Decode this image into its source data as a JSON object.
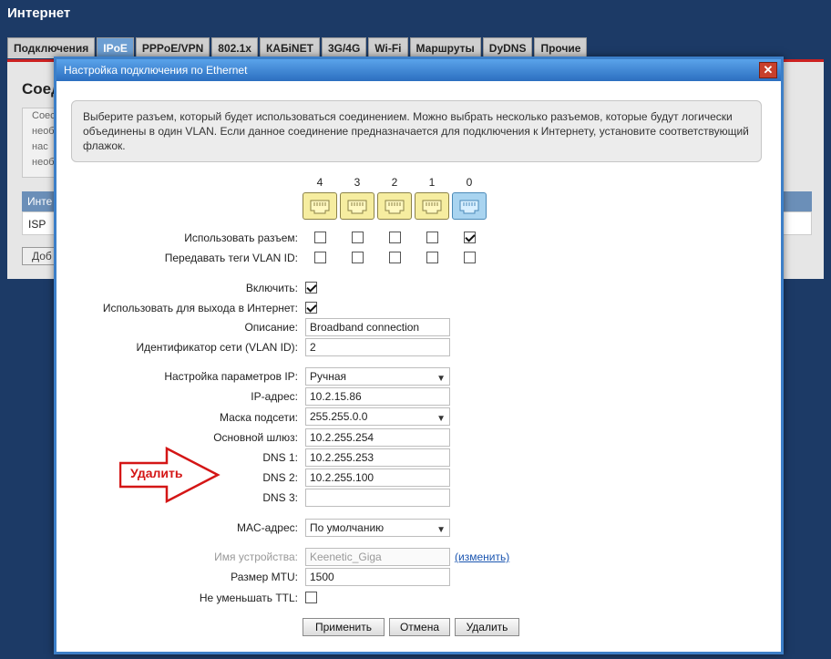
{
  "page": {
    "title": "Интернет",
    "tabs": [
      "Подключения",
      "IPoE",
      "PPPoE/VPN",
      "802.1x",
      "КАБiNET",
      "3G/4G",
      "Wi-Fi",
      "Маршруты",
      "DyDNS",
      "Прочие"
    ],
    "active_tab": "IPoE",
    "bg_heading": "Соед",
    "bg_text": "Соес необ нас необ",
    "bg_table_header": "Инте",
    "bg_table_row": "ISP",
    "bg_add_button": "Доб"
  },
  "dialog": {
    "title": "Настройка подключения по Ethernet",
    "close_label": "✕",
    "info": "Выберите разъем, который будет использоваться соединением. Можно выбрать несколько разъемов, которые будут логически объединены в один VLAN. Если данное соединение предназначается для подключения к Интернету, установите соответствующий флажок."
  },
  "ports": {
    "numbers": [
      "4",
      "3",
      "2",
      "1",
      "0"
    ],
    "use_port_label": "Использовать разъем:",
    "use_port": [
      false,
      false,
      false,
      false,
      true
    ],
    "vlan_tags_label": "Передавать теги VLAN ID:",
    "vlan_tags": [
      false,
      false,
      false,
      false,
      false
    ]
  },
  "form": {
    "enable_label": "Включить:",
    "enable": true,
    "internet_label": "Использовать для выхода в Интернет:",
    "internet": true,
    "description_label": "Описание:",
    "description": "Broadband connection",
    "vlan_label": "Идентификатор сети (VLAN ID):",
    "vlan": "2",
    "ip_mode_label": "Настройка параметров IP:",
    "ip_mode": "Ручная",
    "ip_label": "IP-адрес:",
    "ip": "10.2.15.86",
    "mask_label": "Маска подсети:",
    "mask": "255.255.0.0",
    "gateway_label": "Основной шлюз:",
    "gateway": "10.2.255.254",
    "dns1_label": "DNS 1:",
    "dns1": "10.2.255.253",
    "dns2_label": "DNS 2:",
    "dns2": "10.2.255.100",
    "dns3_label": "DNS 3:",
    "dns3": "",
    "mac_label": "MAC-адрес:",
    "mac": "По умолчанию",
    "device_name_label": "Имя устройства:",
    "device_name": "Keenetic_Giga",
    "change_link": "(изменить)",
    "mtu_label": "Размер MTU:",
    "mtu": "1500",
    "ttl_label": "Не уменьшать TTL:",
    "ttl": false
  },
  "buttons": {
    "apply": "Применить",
    "cancel": "Отмена",
    "delete": "Удалить"
  },
  "annotation": {
    "text": "Удалить",
    "color": "#d41616"
  },
  "colors": {
    "background": "#1c3a66",
    "dialog_border": "#3c7fc8",
    "port_yellow": "#f6eda0",
    "port_blue": "#a9d4f0"
  }
}
